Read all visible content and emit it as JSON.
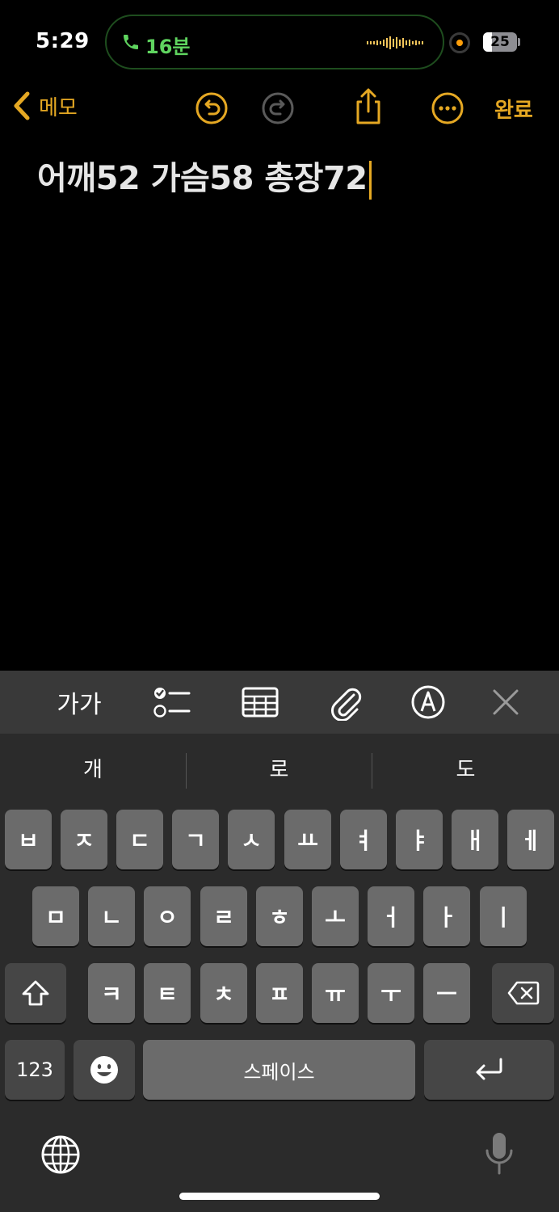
{
  "status": {
    "time": "5:29",
    "call_duration": "16분",
    "battery_level": "25",
    "battery_fraction": 0.25
  },
  "nav": {
    "back_label": "메모",
    "done_label": "완료"
  },
  "note": {
    "text": "어깨52 가슴58 총장72"
  },
  "toolbar": {
    "format_label": "가가"
  },
  "keyboard": {
    "suggestions": [
      "개",
      "로",
      "도"
    ],
    "row1": [
      "ㅂ",
      "ㅈ",
      "ㄷ",
      "ㄱ",
      "ㅅ",
      "ㅛ",
      "ㅕ",
      "ㅑ",
      "ㅐ",
      "ㅔ"
    ],
    "row2": [
      "ㅁ",
      "ㄴ",
      "ㅇ",
      "ㄹ",
      "ㅎ",
      "ㅗ",
      "ㅓ",
      "ㅏ",
      "ㅣ"
    ],
    "row3": [
      "ㅋ",
      "ㅌ",
      "ㅊ",
      "ㅍ",
      "ㅠ",
      "ㅜ",
      "ㅡ"
    ],
    "numbers_label": "123",
    "space_label": "스페이스"
  },
  "colors": {
    "accent": "#e5a823",
    "call_green": "#5fd45f",
    "background": "#000000",
    "keyboard_bg": "#2b2b2b",
    "key_bg": "#6b6b6b"
  }
}
